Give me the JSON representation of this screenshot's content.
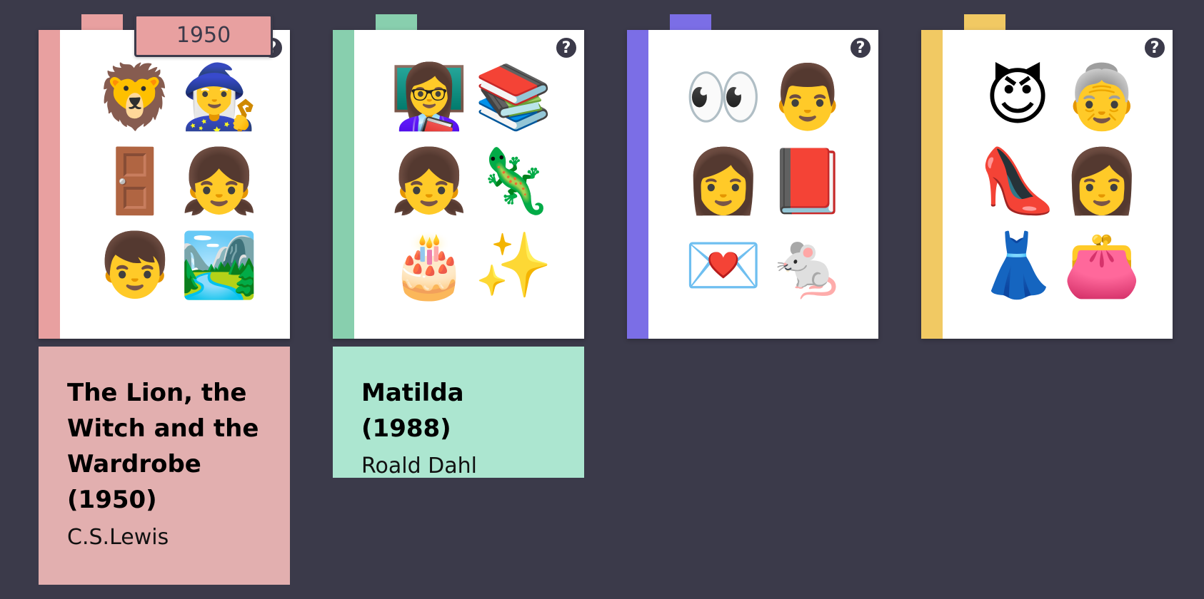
{
  "cards": [
    {
      "color": "#e8a0a0",
      "emojis": [
        "🦁",
        "🧙‍♀️",
        "🚪",
        "👧",
        "👦",
        "🏞️"
      ],
      "help_label": "?"
    },
    {
      "color": "#88cfae",
      "emojis": [
        "👩‍🏫",
        "📚",
        "👧",
        "🦎",
        "🎂",
        "✨"
      ],
      "help_label": "?"
    },
    {
      "color": "#7b6ee6",
      "emojis": [
        "👀",
        "👨",
        "👩",
        "📕",
        "💌",
        "🐁"
      ],
      "help_label": "?"
    },
    {
      "color": "#f1c963",
      "emojis": [
        "😈",
        "👵",
        "👠",
        "👩",
        "👗",
        "👛"
      ],
      "help_label": "?"
    }
  ],
  "drag_label": {
    "text": "1950"
  },
  "answers": [
    {
      "title": "The Lion, the Witch and the Wardrobe (1950)",
      "author": "C.S.Lewis",
      "color": "#e2afaf"
    },
    {
      "title": "Matilda (1988)",
      "author": "Roald Dahl",
      "color": "#ace6d0"
    }
  ]
}
